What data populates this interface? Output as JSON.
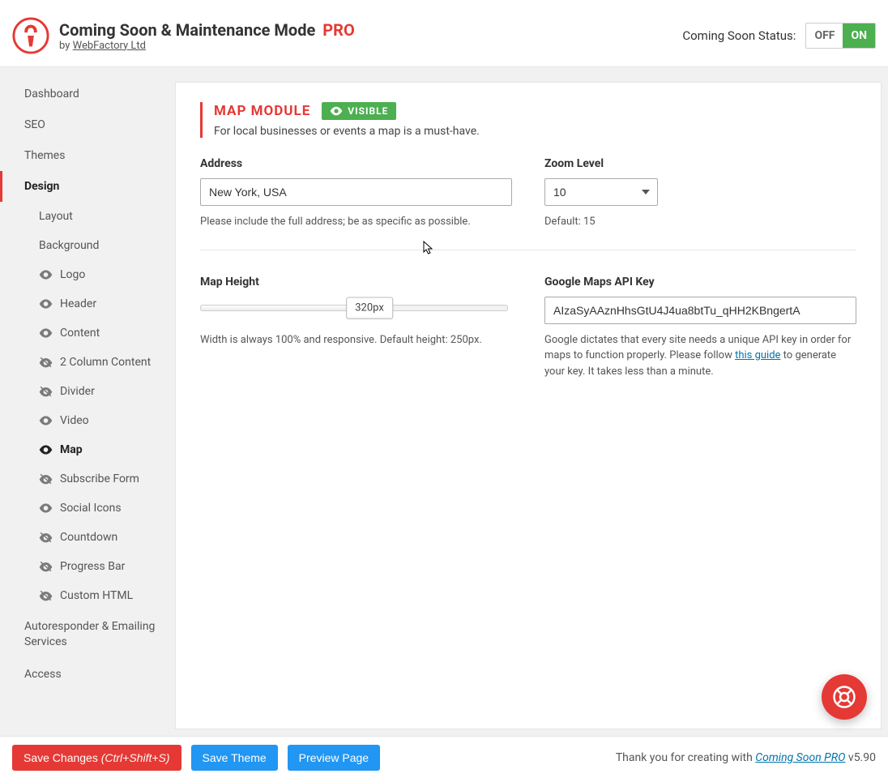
{
  "header": {
    "title_main": "Coming Soon & Maintenance Mode",
    "title_pro": "PRO",
    "by_prefix": "by ",
    "by_link": "WebFactory Ltd",
    "status_label": "Coming Soon Status:",
    "toggle_off": "OFF",
    "toggle_on": "ON"
  },
  "sidebar": {
    "items": [
      "Dashboard",
      "SEO",
      "Themes",
      "Design"
    ],
    "sub": [
      {
        "label": "Layout",
        "visible": null
      },
      {
        "label": "Background",
        "visible": null
      },
      {
        "label": "Logo",
        "visible": true
      },
      {
        "label": "Header",
        "visible": true
      },
      {
        "label": "Content",
        "visible": true
      },
      {
        "label": "2 Column Content",
        "visible": false
      },
      {
        "label": "Divider",
        "visible": false
      },
      {
        "label": "Video",
        "visible": true
      },
      {
        "label": "Map",
        "visible": true,
        "active": true
      },
      {
        "label": "Subscribe Form",
        "visible": false
      },
      {
        "label": "Social Icons",
        "visible": true
      },
      {
        "label": "Countdown",
        "visible": false
      },
      {
        "label": "Progress Bar",
        "visible": false
      },
      {
        "label": "Custom HTML",
        "visible": false
      }
    ],
    "after": [
      "Autoresponder & Emailing Services",
      "Access"
    ]
  },
  "module": {
    "title": "MAP MODULE",
    "badge": "VISIBLE",
    "desc": "For local businesses or events a map is a must-have."
  },
  "fields": {
    "address": {
      "label": "Address",
      "value": "New York, USA",
      "help": "Please include the full address; be as specific as possible."
    },
    "zoom": {
      "label": "Zoom Level",
      "value": "10",
      "help": "Default: 15"
    },
    "height": {
      "label": "Map Height",
      "value": "320px",
      "help": "Width is always 100% and responsive. Default height: 250px."
    },
    "apikey": {
      "label": "Google Maps API Key",
      "value": "AIzaSyAAznHhsGtU4J4ua8btTu_qHH2KBngertA",
      "help_1": "Google dictates that every site needs a unique API key in order for maps to function properly. Please follow ",
      "help_link": "this guide",
      "help_2": " to generate your key. It takes less than a minute."
    }
  },
  "footer": {
    "save_changes": "Save Changes",
    "save_shortcut": "(Ctrl+Shift+S)",
    "save_theme": "Save Theme",
    "preview": "Preview Page",
    "credit_1": "Thank you for creating with ",
    "credit_link": "Coming Soon PRO",
    "credit_ver": " v5.90"
  }
}
